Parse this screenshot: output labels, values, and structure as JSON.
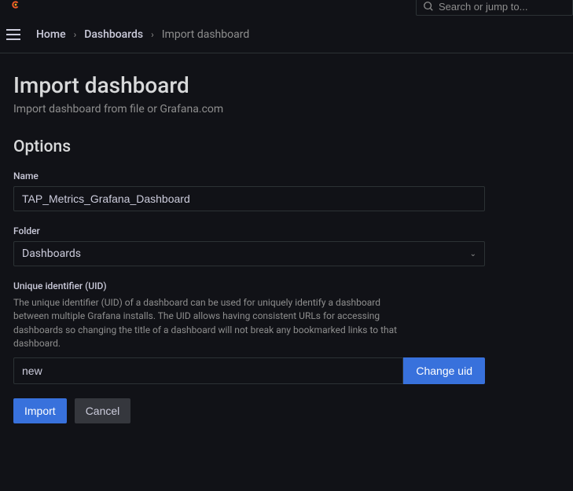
{
  "search": {
    "placeholder": "Search or jump to..."
  },
  "breadcrumb": {
    "home": "Home",
    "dashboards": "Dashboards",
    "current": "Import dashboard"
  },
  "page": {
    "title": "Import dashboard",
    "subtitle": "Import dashboard from file or Grafana.com"
  },
  "options": {
    "heading": "Options",
    "name": {
      "label": "Name",
      "value": "TAP_Metrics_Grafana_Dashboard"
    },
    "folder": {
      "label": "Folder",
      "value": "Dashboards"
    },
    "uid": {
      "label": "Unique identifier (UID)",
      "help": "The unique identifier (UID) of a dashboard can be used for uniquely identify a dashboard between multiple Grafana installs. The UID allows having consistent URLs for accessing dashboards so changing the title of a dashboard will not break any bookmarked links to that dashboard.",
      "value": "new",
      "button": "Change uid"
    }
  },
  "actions": {
    "import": "Import",
    "cancel": "Cancel"
  }
}
